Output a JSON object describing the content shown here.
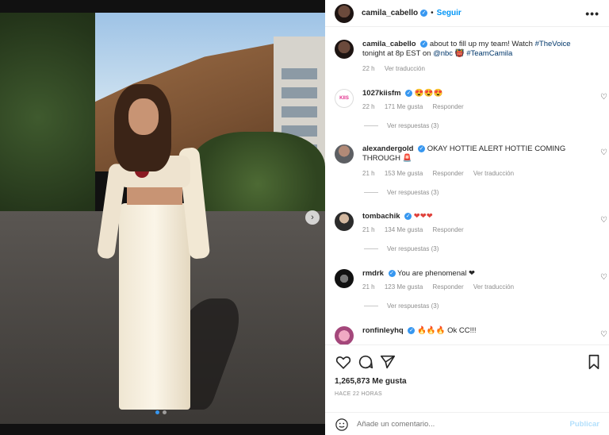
{
  "post": {
    "username": "camila_cabello",
    "follow_label": "Seguir",
    "more_label": "•••",
    "caption": {
      "username": "camila_cabello",
      "text_1": "about to fill up my team! Watch",
      "tag_voice": "#TheVoice",
      "text_2": "tonight at 8p EST on",
      "mention": "@nbc",
      "tag_team": "#TeamCamila",
      "time": "22 h",
      "translate": "Ver traducción"
    }
  },
  "comments": [
    {
      "username": "1027kiisfm",
      "avatar_text": "KIIS",
      "text": "😍😍😍",
      "time": "22 h",
      "likes": "171 Me gusta",
      "reply": "Responder",
      "translate": "",
      "replies": "Ver respuestas (3)"
    },
    {
      "username": "alexandergold",
      "text": "OKAY HOTTIE ALERT HOTTIE COMING THROUGH 🚨",
      "time": "21 h",
      "likes": "153 Me gusta",
      "reply": "Responder",
      "translate": "Ver traducción",
      "replies": "Ver respuestas (3)"
    },
    {
      "username": "tombachik",
      "text": "❤❤❤",
      "time": "21 h",
      "likes": "134 Me gusta",
      "reply": "Responder",
      "translate": "",
      "replies": "Ver respuestas (3)"
    },
    {
      "username": "rmdrk",
      "text": "You are phenomenal ❤",
      "time": "21 h",
      "likes": "123 Me gusta",
      "reply": "Responder",
      "translate": "Ver traducción",
      "replies": "Ver respuestas (3)"
    },
    {
      "username": "ronfinleyhq",
      "text": "🔥🔥🔥 Ok CC!!!"
    }
  ],
  "actions": {
    "likes": "1,265,873 Me gusta",
    "date": "HACE 22 HORAS",
    "comment_placeholder": "Añade un comentario...",
    "post_label": "Publicar"
  },
  "carousel": {
    "current": 1,
    "total": 2
  },
  "colors": {
    "accent": "#0095f6",
    "verified": "#3797f0",
    "muted": "#8e8e8e"
  }
}
